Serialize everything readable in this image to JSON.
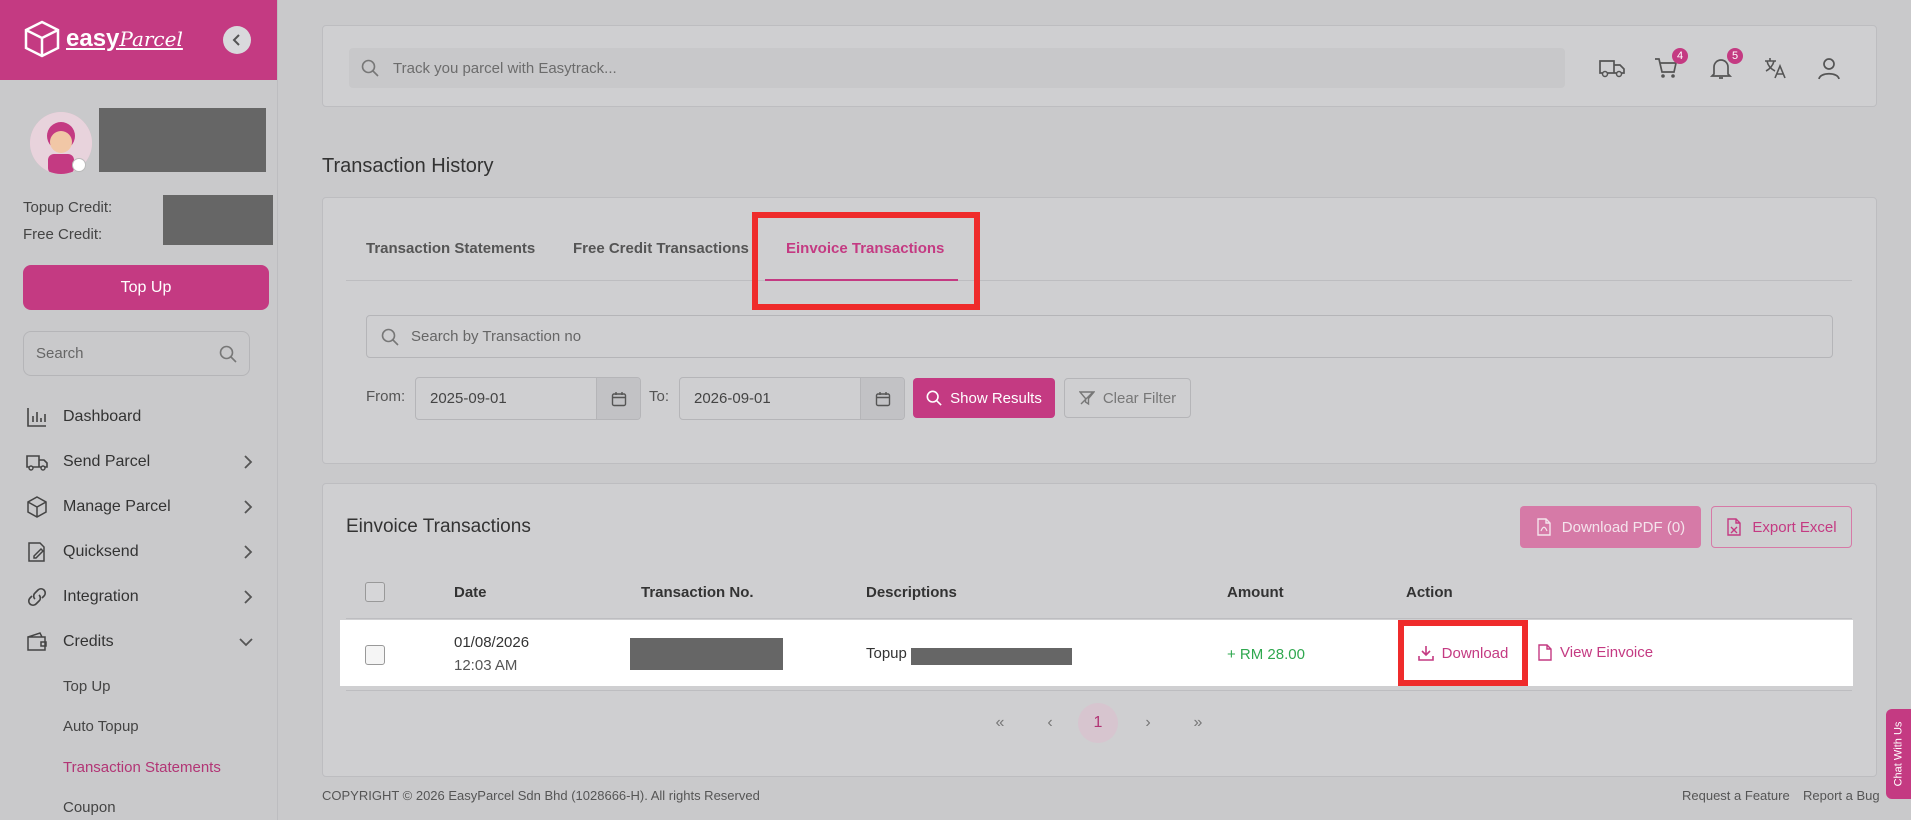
{
  "brand": {
    "name": "easy",
    "script": "Parcel",
    "accent": "#c43a82"
  },
  "sidebar": {
    "topup_credit_label": "Topup Credit:",
    "free_credit_label": "Free Credit:",
    "topup_button": "Top Up",
    "search_placeholder": "Search",
    "items": [
      {
        "label": "Dashboard",
        "icon": "bar-chart-icon"
      },
      {
        "label": "Send Parcel",
        "icon": "truck-icon"
      },
      {
        "label": "Manage Parcel",
        "icon": "box-icon"
      },
      {
        "label": "Quicksend",
        "icon": "edit-icon"
      },
      {
        "label": "Integration",
        "icon": "link-icon"
      },
      {
        "label": "Credits",
        "icon": "wallet-icon"
      }
    ],
    "credits_sub": [
      "Top Up",
      "Auto Topup",
      "Transaction Statements",
      "Coupon"
    ]
  },
  "header": {
    "track_placeholder": "Track you parcel with Easytrack...",
    "cart_badge": "4",
    "notif_badge": "5"
  },
  "page": {
    "title": "Transaction History",
    "tabs": [
      "Transaction Statements",
      "Free Credit Transactions",
      "Einvoice Transactions"
    ],
    "search_placeholder": "Search by Transaction no",
    "from_label": "From:",
    "from_value": "2025-09-01",
    "to_label": "To:",
    "to_value": "2026-09-01",
    "show_results": "Show Results",
    "clear_filter": "Clear Filter"
  },
  "table": {
    "title": "Einvoice Transactions",
    "download_pdf": "Download PDF (0)",
    "export_excel": "Export Excel",
    "columns": [
      "Date",
      "Transaction No.",
      "Descriptions",
      "Amount",
      "Action"
    ],
    "rows": [
      {
        "date": "01/08/2026",
        "time": "12:03 AM",
        "description": "Topup",
        "amount": "+ RM 28.00",
        "download": "Download",
        "view": "View Einvoice"
      }
    ],
    "pagination": {
      "first": "«",
      "prev": "‹",
      "current": "1",
      "next": "›",
      "last": "»"
    }
  },
  "footer": {
    "copyright": "COPYRIGHT © 2026 EasyParcel Sdn Bhd (1028666-H). All rights Reserved",
    "request_feature": "Request a Feature",
    "report_bug": "Report a Bug"
  },
  "chat_label": "Chat With Us"
}
